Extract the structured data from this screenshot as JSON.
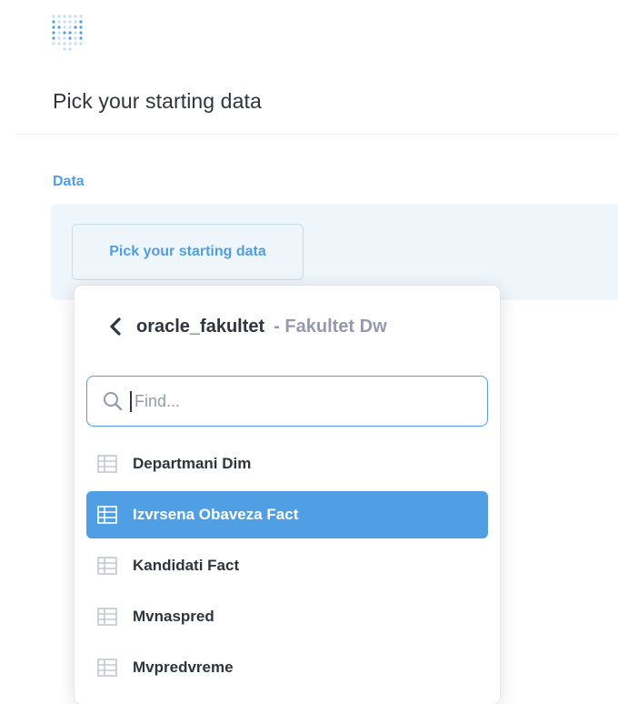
{
  "header": {
    "title": "Pick your starting data"
  },
  "data_section": {
    "label": "Data",
    "pick_button_label": "Pick your starting data"
  },
  "picker": {
    "back_icon": "chevron-left-icon",
    "database_name": "oracle_fakultet",
    "schema_name": "- Fakultet Dw",
    "search": {
      "value": "",
      "placeholder": "Find..."
    },
    "tables": [
      {
        "label": "Departmani Dim",
        "selected": false
      },
      {
        "label": "Izvrsena Obaveza Fact",
        "selected": true
      },
      {
        "label": "Kandidati Fact",
        "selected": false
      },
      {
        "label": "Mvnaspred",
        "selected": false
      },
      {
        "label": "Mvpredvreme",
        "selected": false
      }
    ]
  },
  "colors": {
    "accent": "#509ee3",
    "panel_bg": "#eef6fc",
    "text_dark": "#2e353b",
    "text_muted": "#949aab"
  }
}
